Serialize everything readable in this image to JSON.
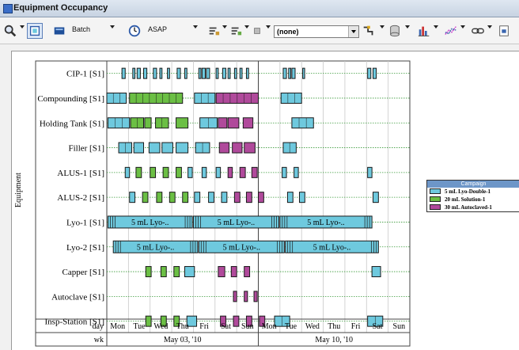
{
  "window": {
    "title": "Equipment Occupancy"
  },
  "toolbar": {
    "batch_label": "Batch",
    "asap_label": "ASAP",
    "combo_value": "(none)"
  },
  "legend": {
    "title": "Campaign",
    "items": [
      {
        "label": "5 mL Lyo-Double-1",
        "color": "#6ec9de"
      },
      {
        "label": "20 mL Solution-1",
        "color": "#6bbf44"
      },
      {
        "label": "30 mL Autoclaved-1",
        "color": "#b04a9b"
      }
    ]
  },
  "chart_data": {
    "type": "gantt",
    "ylabel": "Equipment",
    "rows": [
      "CIP-1 [S1]",
      "Compounding [S1]",
      "Holding Tank [S1]",
      "Filler [S1]",
      "ALUS-1 [S1]",
      "ALUS-2 [S1]",
      "Lyo-1 [S1]",
      "Lyo-2 [S1]",
      "Capper [S1]",
      "Autoclave [S1]",
      "Insp-Station [S1]"
    ],
    "axis_rows": [
      {
        "label": "day",
        "cells": [
          "Mon",
          "Tue",
          "Wed",
          "Thu",
          "Fri",
          "Sat",
          "Sun",
          "Mon",
          "Tue",
          "Wed",
          "Thu",
          "Fri",
          "Sat",
          "Sun"
        ]
      },
      {
        "label": "wk",
        "cells": [
          "May 03, '10",
          "May 10, '10"
        ]
      }
    ],
    "x_range_days": [
      0,
      14
    ],
    "campaigns": [
      "5 mL Lyo-Double-1",
      "20 mL Solution-1",
      "30 mL Autoclaved-1"
    ],
    "bars": [
      {
        "row": 0,
        "start": 0.7,
        "end": 0.85,
        "campaign": 0
      },
      {
        "row": 0,
        "start": 1.2,
        "end": 1.3,
        "campaign": 0
      },
      {
        "row": 0,
        "start": 1.4,
        "end": 1.55,
        "campaign": 0
      },
      {
        "row": 0,
        "start": 1.7,
        "end": 1.85,
        "campaign": 0
      },
      {
        "row": 0,
        "start": 2.15,
        "end": 2.3,
        "campaign": 0
      },
      {
        "row": 0,
        "start": 2.45,
        "end": 2.55,
        "campaign": 0
      },
      {
        "row": 0,
        "start": 2.8,
        "end": 2.9,
        "campaign": 0
      },
      {
        "row": 0,
        "start": 3.25,
        "end": 3.4,
        "campaign": 0
      },
      {
        "row": 0,
        "start": 3.6,
        "end": 3.7,
        "campaign": 0
      },
      {
        "row": 0,
        "start": 4.25,
        "end": 4.35,
        "campaign": 0
      },
      {
        "row": 0,
        "start": 4.4,
        "end": 4.55,
        "campaign": 0
      },
      {
        "row": 0,
        "start": 4.6,
        "end": 4.75,
        "campaign": 0
      },
      {
        "row": 0,
        "start": 5.05,
        "end": 5.15,
        "campaign": 0
      },
      {
        "row": 0,
        "start": 5.35,
        "end": 5.5,
        "campaign": 0
      },
      {
        "row": 0,
        "start": 5.6,
        "end": 5.7,
        "campaign": 0
      },
      {
        "row": 0,
        "start": 5.9,
        "end": 6.0,
        "campaign": 0
      },
      {
        "row": 0,
        "start": 6.15,
        "end": 6.25,
        "campaign": 0
      },
      {
        "row": 0,
        "start": 6.45,
        "end": 6.55,
        "campaign": 0
      },
      {
        "row": 0,
        "start": 8.15,
        "end": 8.3,
        "campaign": 0
      },
      {
        "row": 0,
        "start": 8.4,
        "end": 8.5,
        "campaign": 0
      },
      {
        "row": 0,
        "start": 8.55,
        "end": 8.7,
        "campaign": 0
      },
      {
        "row": 0,
        "start": 9.05,
        "end": 9.1,
        "campaign": 0
      },
      {
        "row": 0,
        "start": 12.05,
        "end": 12.2,
        "campaign": 0
      },
      {
        "row": 0,
        "start": 12.3,
        "end": 12.45,
        "campaign": 0
      },
      {
        "row": 1,
        "start": 0.0,
        "end": 0.9,
        "campaign": 0
      },
      {
        "row": 1,
        "start": 1.05,
        "end": 3.5,
        "campaign": 1
      },
      {
        "row": 1,
        "start": 4.05,
        "end": 5.0,
        "campaign": 0
      },
      {
        "row": 1,
        "start": 5.05,
        "end": 7.0,
        "campaign": 2
      },
      {
        "row": 1,
        "start": 8.05,
        "end": 9.0,
        "campaign": 0
      },
      {
        "row": 2,
        "start": 0.05,
        "end": 1.05,
        "campaign": 0
      },
      {
        "row": 2,
        "start": 1.1,
        "end": 1.7,
        "campaign": 1
      },
      {
        "row": 2,
        "start": 1.75,
        "end": 2.05,
        "campaign": 1
      },
      {
        "row": 2,
        "start": 2.25,
        "end": 2.85,
        "campaign": 1
      },
      {
        "row": 2,
        "start": 3.2,
        "end": 3.75,
        "campaign": 1
      },
      {
        "row": 2,
        "start": 4.3,
        "end": 5.1,
        "campaign": 0
      },
      {
        "row": 2,
        "start": 5.15,
        "end": 5.55,
        "campaign": 2
      },
      {
        "row": 2,
        "start": 5.6,
        "end": 6.1,
        "campaign": 2
      },
      {
        "row": 2,
        "start": 6.3,
        "end": 6.75,
        "campaign": 2
      },
      {
        "row": 2,
        "start": 8.55,
        "end": 9.55,
        "campaign": 0
      },
      {
        "row": 3,
        "start": 0.55,
        "end": 1.15,
        "campaign": 0
      },
      {
        "row": 3,
        "start": 1.25,
        "end": 1.7,
        "campaign": 0
      },
      {
        "row": 3,
        "start": 1.95,
        "end": 2.45,
        "campaign": 0
      },
      {
        "row": 3,
        "start": 2.55,
        "end": 3.05,
        "campaign": 0
      },
      {
        "row": 3,
        "start": 3.2,
        "end": 3.75,
        "campaign": 0
      },
      {
        "row": 3,
        "start": 4.1,
        "end": 4.75,
        "campaign": 0
      },
      {
        "row": 3,
        "start": 5.2,
        "end": 5.65,
        "campaign": 2
      },
      {
        "row": 3,
        "start": 5.8,
        "end": 6.25,
        "campaign": 2
      },
      {
        "row": 3,
        "start": 6.35,
        "end": 6.85,
        "campaign": 2
      },
      {
        "row": 3,
        "start": 8.15,
        "end": 8.75,
        "campaign": 0
      },
      {
        "row": 4,
        "start": 0.85,
        "end": 1.05,
        "campaign": 0
      },
      {
        "row": 4,
        "start": 1.35,
        "end": 1.6,
        "campaign": 1
      },
      {
        "row": 4,
        "start": 2.0,
        "end": 2.25,
        "campaign": 1
      },
      {
        "row": 4,
        "start": 2.6,
        "end": 2.85,
        "campaign": 1
      },
      {
        "row": 4,
        "start": 3.2,
        "end": 3.45,
        "campaign": 1
      },
      {
        "row": 4,
        "start": 3.75,
        "end": 3.95,
        "campaign": 0
      },
      {
        "row": 4,
        "start": 4.4,
        "end": 4.6,
        "campaign": 0
      },
      {
        "row": 4,
        "start": 5.05,
        "end": 5.25,
        "campaign": 0
      },
      {
        "row": 4,
        "start": 5.6,
        "end": 5.8,
        "campaign": 2
      },
      {
        "row": 4,
        "start": 6.15,
        "end": 6.4,
        "campaign": 2
      },
      {
        "row": 4,
        "start": 6.7,
        "end": 6.95,
        "campaign": 2
      },
      {
        "row": 4,
        "start": 8.1,
        "end": 8.3,
        "campaign": 0
      },
      {
        "row": 4,
        "start": 8.65,
        "end": 8.85,
        "campaign": 0
      },
      {
        "row": 4,
        "start": 12.05,
        "end": 12.25,
        "campaign": 0
      },
      {
        "row": 5,
        "start": 1.05,
        "end": 1.3,
        "campaign": 0
      },
      {
        "row": 5,
        "start": 1.65,
        "end": 1.9,
        "campaign": 1
      },
      {
        "row": 5,
        "start": 2.3,
        "end": 2.55,
        "campaign": 1
      },
      {
        "row": 5,
        "start": 2.9,
        "end": 3.15,
        "campaign": 1
      },
      {
        "row": 5,
        "start": 3.5,
        "end": 3.75,
        "campaign": 1
      },
      {
        "row": 5,
        "start": 4.05,
        "end": 4.3,
        "campaign": 0
      },
      {
        "row": 5,
        "start": 4.7,
        "end": 4.95,
        "campaign": 0
      },
      {
        "row": 5,
        "start": 5.3,
        "end": 5.55,
        "campaign": 0
      },
      {
        "row": 5,
        "start": 5.9,
        "end": 6.15,
        "campaign": 2
      },
      {
        "row": 5,
        "start": 6.45,
        "end": 6.7,
        "campaign": 2
      },
      {
        "row": 5,
        "start": 7.0,
        "end": 7.25,
        "campaign": 2
      },
      {
        "row": 5,
        "start": 8.35,
        "end": 8.6,
        "campaign": 0
      },
      {
        "row": 5,
        "start": 8.9,
        "end": 9.15,
        "campaign": 0
      },
      {
        "row": 5,
        "start": 12.3,
        "end": 12.55,
        "campaign": 0
      },
      {
        "row": 6,
        "start": 0.05,
        "end": 3.95,
        "campaign": 0,
        "label": "5 mL Lyo-.."
      },
      {
        "row": 6,
        "start": 4.0,
        "end": 7.95,
        "campaign": 0,
        "label": "5 mL Lyo-.."
      },
      {
        "row": 6,
        "start": 8.0,
        "end": 12.25,
        "campaign": 0,
        "label": "5 mL Lyo-.."
      },
      {
        "row": 7,
        "start": 0.3,
        "end": 4.2,
        "campaign": 0,
        "label": "5 mL Lyo-.."
      },
      {
        "row": 7,
        "start": 4.25,
        "end": 8.2,
        "campaign": 0,
        "label": "5 mL Lyo-.."
      },
      {
        "row": 7,
        "start": 8.25,
        "end": 12.55,
        "campaign": 0,
        "label": "5 mL Lyo-.."
      },
      {
        "row": 8,
        "start": 1.8,
        "end": 2.05,
        "campaign": 1
      },
      {
        "row": 8,
        "start": 2.5,
        "end": 2.75,
        "campaign": 1
      },
      {
        "row": 8,
        "start": 3.1,
        "end": 3.35,
        "campaign": 1
      },
      {
        "row": 8,
        "start": 3.6,
        "end": 4.05,
        "campaign": 0
      },
      {
        "row": 8,
        "start": 5.15,
        "end": 5.45,
        "campaign": 2
      },
      {
        "row": 8,
        "start": 5.75,
        "end": 6.0,
        "campaign": 2
      },
      {
        "row": 8,
        "start": 6.35,
        "end": 6.6,
        "campaign": 2
      },
      {
        "row": 8,
        "start": 12.25,
        "end": 12.65,
        "campaign": 0
      },
      {
        "row": 9,
        "start": 5.85,
        "end": 6.0,
        "campaign": 2
      },
      {
        "row": 9,
        "start": 6.35,
        "end": 6.5,
        "campaign": 2
      },
      {
        "row": 9,
        "start": 6.8,
        "end": 6.95,
        "campaign": 2
      },
      {
        "row": 10,
        "start": 1.8,
        "end": 2.05,
        "campaign": 1
      },
      {
        "row": 10,
        "start": 2.5,
        "end": 2.75,
        "campaign": 1
      },
      {
        "row": 10,
        "start": 3.1,
        "end": 3.35,
        "campaign": 1
      },
      {
        "row": 10,
        "start": 3.7,
        "end": 4.15,
        "campaign": 0
      },
      {
        "row": 10,
        "start": 5.25,
        "end": 5.5,
        "campaign": 2
      },
      {
        "row": 10,
        "start": 5.85,
        "end": 6.1,
        "campaign": 2
      },
      {
        "row": 10,
        "start": 6.45,
        "end": 6.7,
        "campaign": 2
      },
      {
        "row": 10,
        "start": 7.05,
        "end": 7.3,
        "campaign": 2
      },
      {
        "row": 10,
        "start": 7.75,
        "end": 8.45,
        "campaign": 0
      },
      {
        "row": 10,
        "start": 12.05,
        "end": 12.75,
        "campaign": 0
      }
    ]
  }
}
